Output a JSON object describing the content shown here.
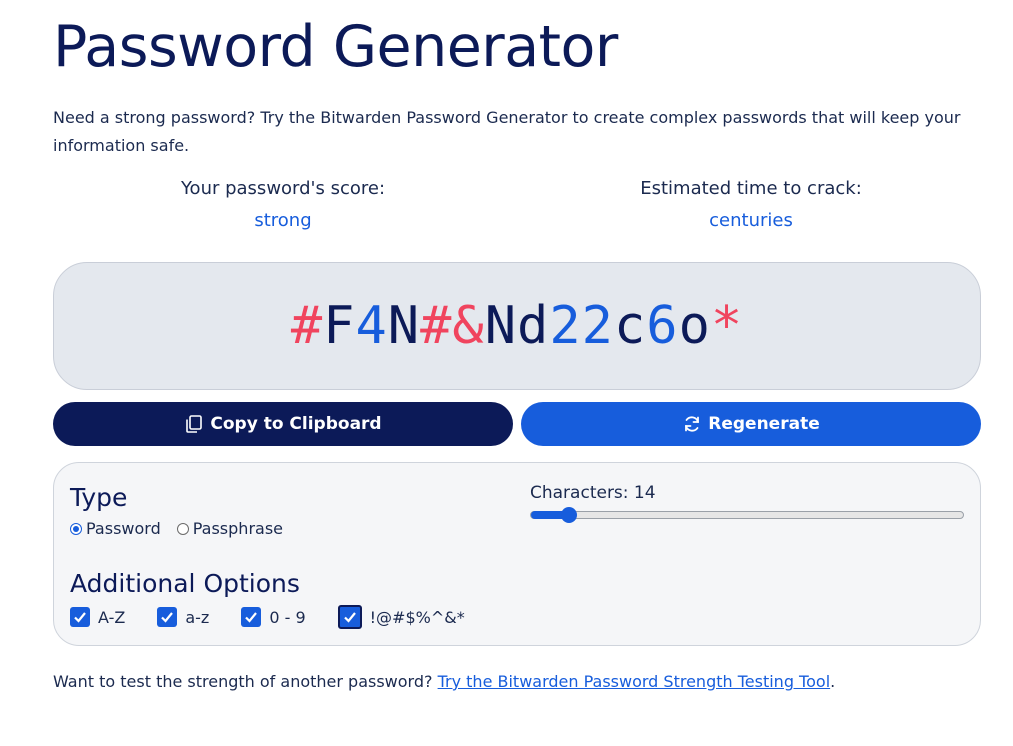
{
  "page": {
    "title": "Password Generator",
    "intro": "Need a strong password? Try the Bitwarden Password Generator to create complex passwords that will keep your information safe."
  },
  "score": {
    "label": "Your password's score:",
    "value": "strong"
  },
  "crack": {
    "label": "Estimated time to crack:",
    "value": "centuries"
  },
  "password": {
    "value": "#F4N#&Nd22c6o*",
    "colors": {
      "special": "#f0445e",
      "digit": "#175ddc",
      "letter": "#0c1a58"
    }
  },
  "buttons": {
    "copy": {
      "label": "Copy to Clipboard",
      "icon": "copy-icon"
    },
    "regenerate": {
      "label": "Regenerate",
      "icon": "refresh-icon"
    }
  },
  "options": {
    "type_heading": "Type",
    "type_options": [
      {
        "label": "Password",
        "checked": true
      },
      {
        "label": "Passphrase",
        "checked": false
      }
    ],
    "characters": {
      "label": "Characters: 14",
      "value": 14,
      "min": 5,
      "max": 128
    },
    "additional_heading": "Additional Options",
    "checkboxes": [
      {
        "label": "A-Z",
        "checked": true
      },
      {
        "label": "a-z",
        "checked": true
      },
      {
        "label": "0 - 9",
        "checked": true
      },
      {
        "label": "!@#$%^&*",
        "checked": true
      }
    ]
  },
  "footer": {
    "text": "Want to test the strength of another password? ",
    "link": "Try the Bitwarden Password Strength Testing Tool",
    "suffix": "."
  },
  "theme": {
    "navy": "#0c1a58",
    "blue": "#175ddc",
    "pink": "#f0445e"
  }
}
